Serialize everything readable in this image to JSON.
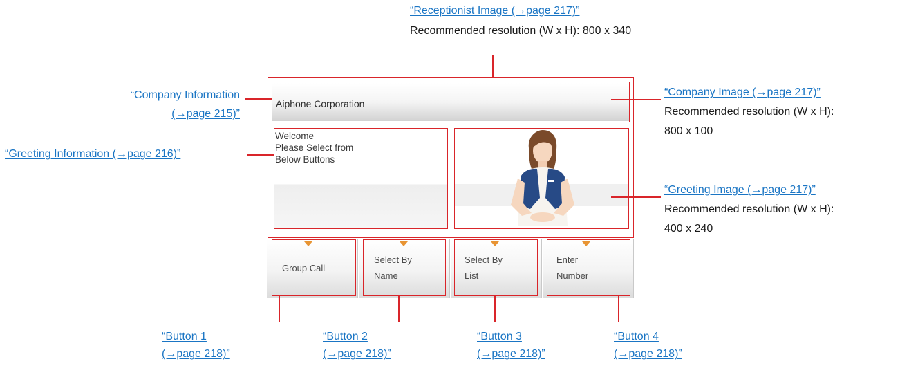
{
  "callouts": {
    "receptionist": {
      "link": "“Receptionist Image (→page 217)”",
      "res": "Recommended resolution (W x H): 800 x 340"
    },
    "company_info": {
      "line1": "“Company Information",
      "line2": "(→page 215)”"
    },
    "greeting_info": {
      "link": "“Greeting Information (→page 216)”"
    },
    "company_image": {
      "link": "“Company Image (→page 217)”",
      "res1": "Recommended resolution (W x H):",
      "res2": "800 x 100"
    },
    "greeting_image": {
      "link": "“Greeting Image (→page 217)”",
      "res1": "Recommended resolution (W x H):",
      "res2": "400 x 240"
    },
    "buttons": [
      {
        "line1": "“Button 1",
        "line2": "(→page 218)”"
      },
      {
        "line1": "“Button 2",
        "line2": "(→page 218)”"
      },
      {
        "line1": "“Button 3",
        "line2": "(→page 218)”"
      },
      {
        "line1": "“Button 4",
        "line2": "(→page 218)”"
      }
    ]
  },
  "screen": {
    "company_name": "Aiphone Corporation",
    "greeting_lines": [
      "Welcome",
      "Please Select from",
      "Below Buttons"
    ],
    "buttons": [
      {
        "label": "Group Call"
      },
      {
        "label": "Select By\nName"
      },
      {
        "label": "Select By\nList"
      },
      {
        "label": "Enter\nNumber"
      }
    ]
  },
  "colors": {
    "callout_link": "#1a75c4",
    "outline": "#d9252a",
    "button_marker": "#e89433"
  }
}
